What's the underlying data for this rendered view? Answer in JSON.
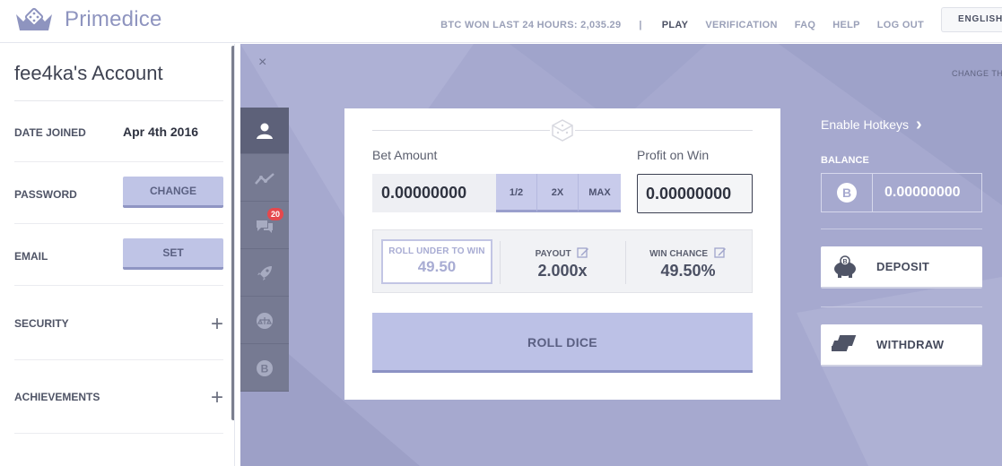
{
  "header": {
    "brand": "Primedice",
    "btc_won": "BTC WON LAST 24 HOURS: 2,035.29",
    "separator": "|",
    "nav": [
      "PLAY",
      "VERIFICATION",
      "FAQ",
      "HELP",
      "LOG OUT"
    ],
    "language": "ENGLISH"
  },
  "account": {
    "title": "fee4ka's Account",
    "date_joined_label": "DATE JOINED",
    "date_joined_value": "Apr 4th 2016",
    "password_label": "PASSWORD",
    "password_button": "CHANGE",
    "email_label": "EMAIL",
    "email_button": "SET",
    "security_label": "SECURITY",
    "achievements_label": "ACHIEVEMENTS",
    "expand_symbol": "+"
  },
  "panel": {
    "close_symbol": "×",
    "change_theme": "CHANGE THE",
    "chat_badge": "20"
  },
  "dice": {
    "bet_amount_label": "Bet Amount",
    "bet_amount_value": "0.00000000",
    "half_button": "1/2",
    "double_button": "2X",
    "max_button": "MAX",
    "profit_label": "Profit on Win",
    "profit_value": "0.00000000",
    "roll_under_label": "ROLL UNDER TO WIN",
    "roll_under_value": "49.50",
    "payout_label": "PAYOUT",
    "payout_value": "2.000x",
    "win_chance_label": "WIN CHANCE",
    "win_chance_value": "49.50%",
    "roll_button": "ROLL DICE"
  },
  "sidebar_right": {
    "hotkeys": "Enable Hotkeys",
    "hotkeys_chevron": "›",
    "balance_label": "BALANCE",
    "balance_value": "0.00000000",
    "deposit_button": "DEPOSIT",
    "withdraw_button": "WITHDRAW"
  },
  "colors": {
    "accent": "#bcc1e6",
    "background": "#a6a9cf",
    "rail": "#767a92",
    "badge": "#e5484d"
  }
}
